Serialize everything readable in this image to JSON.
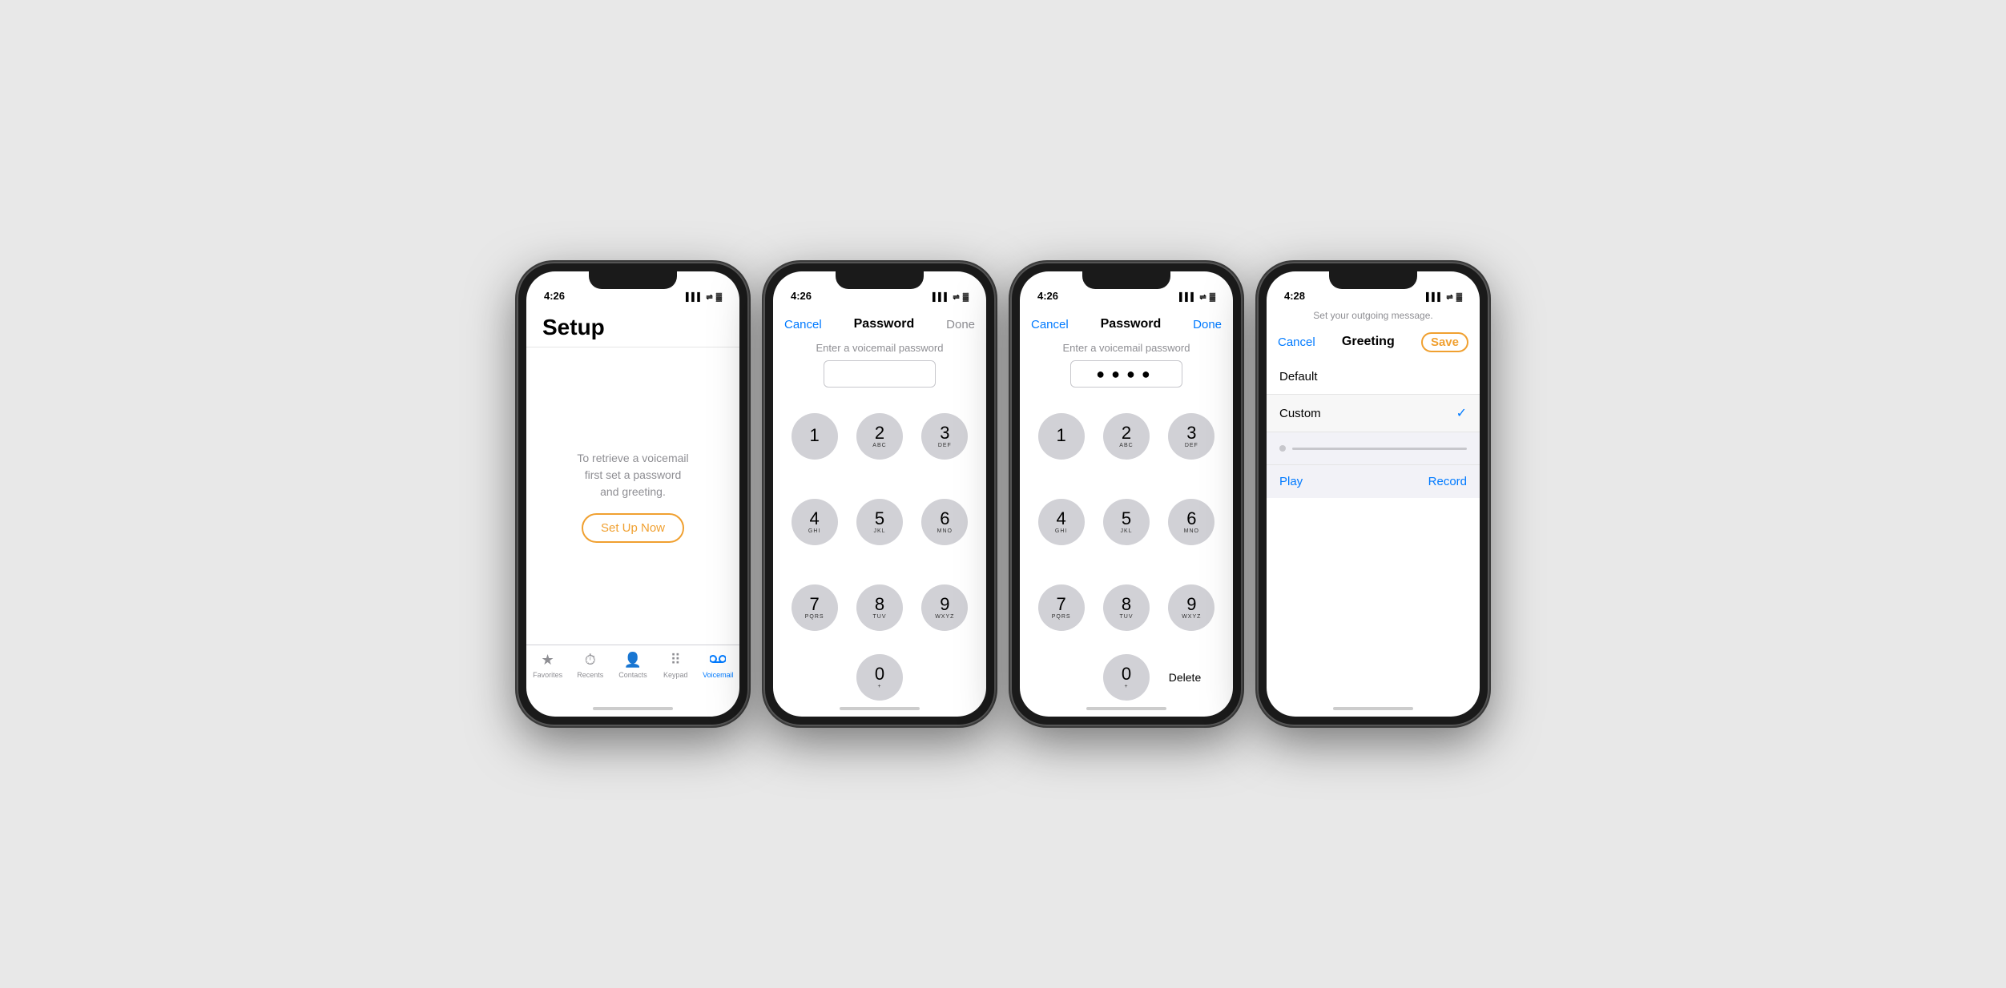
{
  "phone1": {
    "status": {
      "time": "4:26",
      "location": "↗",
      "signal": "▌▌▌",
      "wifi": "WiFi",
      "battery": "🔋"
    },
    "screen": {
      "title": "Setup",
      "description": "To retrieve a voicemail\nfirst set a password\nand greeting.",
      "setup_btn": "Set Up Now"
    },
    "tabs": [
      {
        "icon": "★",
        "label": "Favorites",
        "active": false
      },
      {
        "icon": "🕐",
        "label": "Recents",
        "active": false
      },
      {
        "icon": "👤",
        "label": "Contacts",
        "active": false
      },
      {
        "icon": "⠿",
        "label": "Keypad",
        "active": false
      },
      {
        "icon": "∞",
        "label": "Voicemail",
        "active": true
      }
    ]
  },
  "phone2": {
    "status": {
      "time": "4:26"
    },
    "nav": {
      "cancel": "Cancel",
      "title": "Password",
      "done": "Done",
      "done_active": false
    },
    "password_hint": "Enter a voicemail password",
    "password_value": "",
    "keypad": [
      {
        "num": "1",
        "letters": ""
      },
      {
        "num": "2",
        "letters": "ABC"
      },
      {
        "num": "3",
        "letters": "DEF"
      },
      {
        "num": "4",
        "letters": "GHI"
      },
      {
        "num": "5",
        "letters": "JKL"
      },
      {
        "num": "6",
        "letters": "MNO"
      },
      {
        "num": "7",
        "letters": "PQRS"
      },
      {
        "num": "8",
        "letters": "TUV"
      },
      {
        "num": "9",
        "letters": "WXYZ"
      },
      {
        "num": "0",
        "letters": "+"
      }
    ]
  },
  "phone3": {
    "status": {
      "time": "4:26"
    },
    "nav": {
      "cancel": "Cancel",
      "title": "Password",
      "done": "Done",
      "done_active": true
    },
    "password_hint": "Enter a voicemail password",
    "password_value": "••••",
    "delete_label": "Delete",
    "keypad": [
      {
        "num": "1",
        "letters": ""
      },
      {
        "num": "2",
        "letters": "ABC"
      },
      {
        "num": "3",
        "letters": "DEF"
      },
      {
        "num": "4",
        "letters": "GHI"
      },
      {
        "num": "5",
        "letters": "JKL"
      },
      {
        "num": "6",
        "letters": "MNO"
      },
      {
        "num": "7",
        "letters": "PQRS"
      },
      {
        "num": "8",
        "letters": "TUV"
      },
      {
        "num": "9",
        "letters": "WXYZ"
      },
      {
        "num": "0",
        "letters": "+"
      }
    ]
  },
  "phone4": {
    "status": {
      "time": "4:28"
    },
    "nav": {
      "cancel": "Cancel",
      "title": "Greeting",
      "save": "Save"
    },
    "hint": "Set your outgoing message.",
    "items": [
      {
        "label": "Default",
        "selected": false
      },
      {
        "label": "Custom",
        "selected": true
      }
    ],
    "play_label": "Play",
    "record_label": "Record"
  }
}
